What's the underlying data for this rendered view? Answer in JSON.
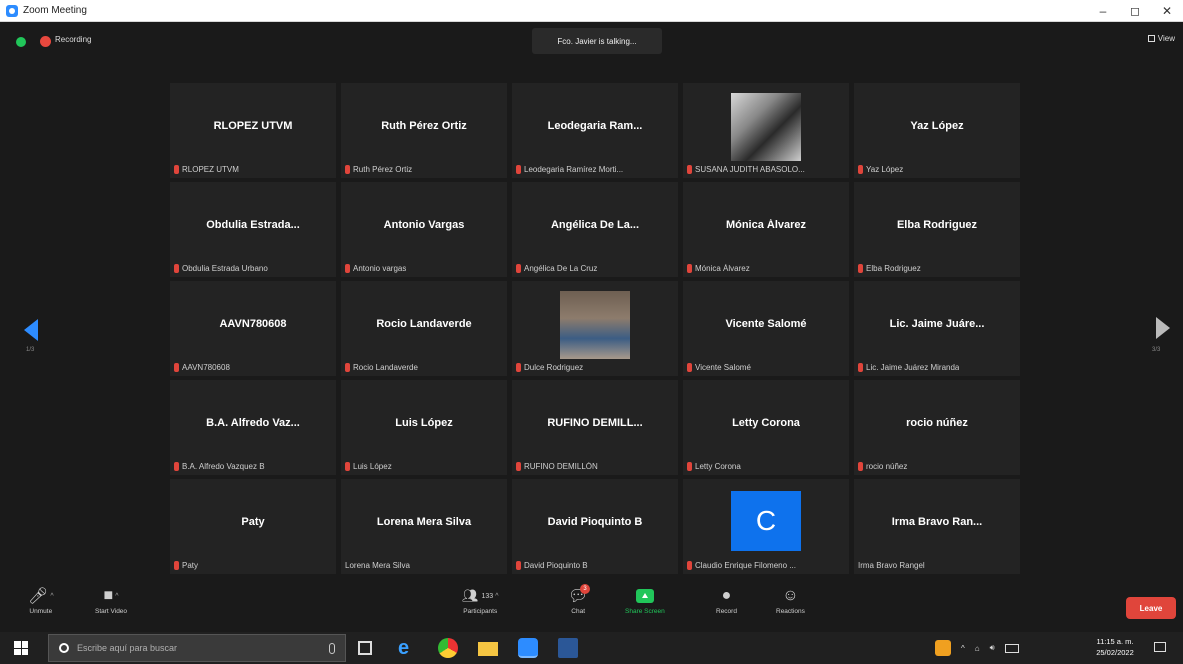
{
  "window": {
    "title": "Zoom Meeting",
    "minimize": "–",
    "maximize": "◻",
    "close": "✕"
  },
  "topbar": {
    "recording_label": "Recording",
    "talking_text": "Fco. Javier is talking...",
    "view_label": "View"
  },
  "colors": {
    "accent": "#2d8cff",
    "muted_mic": "#e0453b",
    "leave": "#e0453b",
    "share": "#21c65a"
  },
  "tiles": [
    {
      "display_name": "RLOPEZ UTVM",
      "label": "RLOPEZ UTVM",
      "muted": true,
      "kind": "name"
    },
    {
      "display_name": "Ruth Pérez Ortiz",
      "label": "Ruth Pérez Ortiz",
      "muted": true,
      "kind": "name"
    },
    {
      "display_name": "Leodegaria Ram...",
      "label": "Leodegaria Ramírez Morti...",
      "muted": true,
      "kind": "name"
    },
    {
      "display_name": "",
      "label": "SUSANA JUDITH ABASOLO...",
      "muted": true,
      "kind": "photo1"
    },
    {
      "display_name": "Yaz López",
      "label": "Yaz López",
      "muted": true,
      "kind": "name"
    },
    {
      "display_name": "Obdulia Estrada...",
      "label": "Obdulia Estrada Urbano",
      "muted": true,
      "kind": "name"
    },
    {
      "display_name": "Antonio Vargas",
      "label": "Antonio vargas",
      "muted": true,
      "kind": "name"
    },
    {
      "display_name": "Angélica De La...",
      "label": "Angélica De La Cruz",
      "muted": true,
      "kind": "name"
    },
    {
      "display_name": "Mónica Álvarez",
      "label": "Mónica Álvarez",
      "muted": true,
      "kind": "name"
    },
    {
      "display_name": "Elba Rodriguez",
      "label": "Elba Rodriguez",
      "muted": true,
      "kind": "name"
    },
    {
      "display_name": "AAVN780608",
      "label": "AAVN780608",
      "muted": true,
      "kind": "name"
    },
    {
      "display_name": "Rocio Landaverde",
      "label": "Rocio Landaverde",
      "muted": true,
      "kind": "name"
    },
    {
      "display_name": "",
      "label": "Dulce Rodriguez",
      "muted": true,
      "kind": "photo2"
    },
    {
      "display_name": "Vicente Salomé",
      "label": "Vicente Salomé",
      "muted": true,
      "kind": "name"
    },
    {
      "display_name": "Lic. Jaime Juáre...",
      "label": "Lic. Jaime Juárez Miranda",
      "muted": true,
      "kind": "name"
    },
    {
      "display_name": "B.A. Alfredo Vaz...",
      "label": "B.A. Alfredo Vazquez B",
      "muted": true,
      "kind": "name"
    },
    {
      "display_name": "Luis López",
      "label": "Luis López",
      "muted": true,
      "kind": "name"
    },
    {
      "display_name": "RUFINO DEMILL...",
      "label": "RUFINO DEMILLÓN",
      "muted": true,
      "kind": "name"
    },
    {
      "display_name": "Letty Corona",
      "label": "Letty Corona",
      "muted": true,
      "kind": "name"
    },
    {
      "display_name": "rocio núñez",
      "label": "rocio núñez",
      "muted": true,
      "kind": "name"
    },
    {
      "display_name": "Paty",
      "label": "Paty",
      "muted": true,
      "kind": "name"
    },
    {
      "display_name": "Lorena Mera Silva",
      "label": "Lorena Mera Silva",
      "muted": false,
      "kind": "name"
    },
    {
      "display_name": "David Pioquinto B",
      "label": "David Pioquinto B",
      "muted": true,
      "kind": "name"
    },
    {
      "display_name": "C",
      "label": "Claudio Enrique Filomeno ...",
      "muted": true,
      "kind": "avatar"
    },
    {
      "display_name": "Irma Bravo Ran...",
      "label": "Irma Bravo Rangel",
      "muted": false,
      "kind": "name"
    }
  ],
  "nav": {
    "left_page": "1/3",
    "right_page": "3/3"
  },
  "toolbar": {
    "unmute": "Unmute",
    "start_video": "Start Video",
    "participants": "Participants",
    "participants_count": "133",
    "chat": "Chat",
    "chat_badge": "3",
    "share_screen": "Share Screen",
    "record": "Record",
    "reactions": "Reactions",
    "leave": "Leave"
  },
  "taskbar": {
    "search_placeholder": "Escribe aquí para buscar",
    "clock_time": "11:15 a. m.",
    "clock_date": "25/02/2022"
  }
}
